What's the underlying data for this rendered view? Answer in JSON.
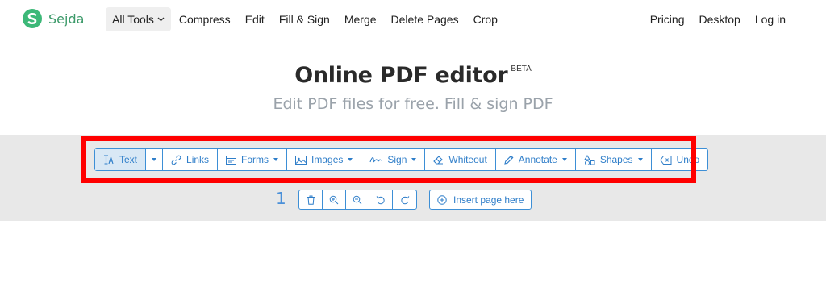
{
  "brand": {
    "name": "Sejda",
    "logo_letter": "S",
    "logo_color": "#3cb878"
  },
  "nav": {
    "all_tools": "All Tools",
    "links": [
      "Compress",
      "Edit",
      "Fill & Sign",
      "Merge",
      "Delete Pages",
      "Crop"
    ],
    "right_links": [
      "Pricing",
      "Desktop",
      "Log in"
    ]
  },
  "heading": {
    "title": "Online PDF editor",
    "badge": "BETA",
    "subtitle": "Edit PDF files for free. Fill & sign PDF"
  },
  "toolbar": {
    "items": [
      {
        "label": "Text",
        "icon": "text-cursor-icon",
        "active": true
      },
      {
        "label": "",
        "icon": "caret-down-icon"
      },
      {
        "label": "Links",
        "icon": "link-icon"
      },
      {
        "label": "Forms",
        "icon": "form-icon",
        "dropdown": true
      },
      {
        "label": "Images",
        "icon": "image-icon",
        "dropdown": true
      },
      {
        "label": "Sign",
        "icon": "signature-icon",
        "dropdown": true
      },
      {
        "label": "Whiteout",
        "icon": "eraser-icon"
      },
      {
        "label": "Annotate",
        "icon": "pencil-icon",
        "dropdown": true
      },
      {
        "label": "Shapes",
        "icon": "shapes-icon",
        "dropdown": true
      },
      {
        "label": "Undo",
        "icon": "backspace-icon"
      }
    ]
  },
  "page_controls": {
    "page_number": "1",
    "buttons": [
      "trash-icon",
      "zoom-in-icon",
      "zoom-out-icon",
      "rotate-left-icon",
      "rotate-right-icon"
    ],
    "insert_label": "Insert page here"
  },
  "colors": {
    "accent": "#2f7ec9",
    "highlight": "#ff0000",
    "band": "#e8e8e8",
    "active_bg": "#d9e8f5"
  }
}
